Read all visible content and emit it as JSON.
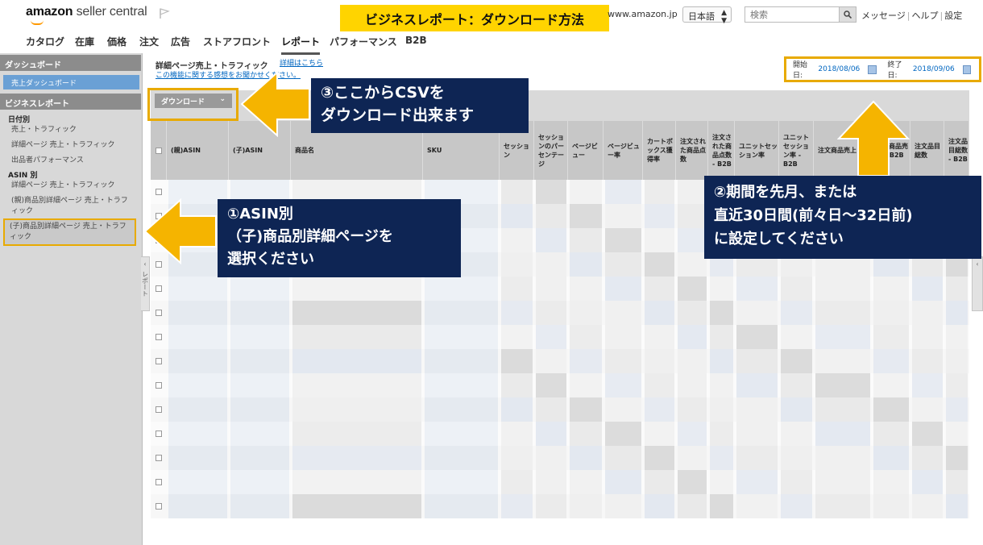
{
  "header": {
    "logo_main": "amazon",
    "logo_sub": "seller central",
    "banner": "ビジネスレポート：ダウンロード方法",
    "domain": "www.amazon.jp",
    "language": "日本語",
    "search_placeholder": "検索",
    "links": [
      "メッセージ",
      "ヘルプ",
      "設定"
    ]
  },
  "nav": {
    "items": [
      "カタログ",
      "在庫",
      "価格",
      "注文",
      "広告",
      "ストアフロント",
      "レポート",
      "パフォーマンス",
      "B2B"
    ],
    "active": "レポート"
  },
  "sidebar": {
    "dashboard_head": "ダッシュボード",
    "dashboard_item": "売上ダッシュボード",
    "report_head": "ビジネスレポート",
    "by_date_label": "日付別",
    "by_date_items": [
      "売上・トラフィック",
      "詳細ページ 売上・トラフィック",
      "出品者パフォーマンス"
    ],
    "by_asin_label": "ASIN 別",
    "by_asin_items": [
      "詳細ページ 売上・トラフィック",
      "(親)商品別詳細ページ 売上・トラフィック",
      "(子)商品別詳細ページ 売上・トラフィック"
    ],
    "toggle_label": "レポート"
  },
  "main": {
    "title": "詳細ページ売上・トラフィック",
    "detail_link": "詳細はこちら",
    "feedback_link": "この機能に関する感想をお聞かせください。",
    "start_label": "開始日:",
    "start_value": "2018/08/06",
    "end_label": "終了日:",
    "end_value": "2018/09/06",
    "download_label": "ダウンロード"
  },
  "table": {
    "columns": [
      "(親)ASIN",
      "(子)ASIN",
      "商品名",
      "SKU",
      "セッション",
      "セッションのパーセンテージ",
      "ページビュー",
      "ページビュー率",
      "カートボックス獲得率",
      "注文された商品点数",
      "注文された商品点数 - B2B",
      "ユニットセッション率",
      "ユニットセッション率 - B2B",
      "注文商品売上",
      "注文商品売上 - B2B",
      "注文品目総数",
      "注文品目総数 - B2B"
    ],
    "row_count": 14
  },
  "callouts": {
    "one": [
      "①ASIN別",
      "（子)商品別詳細ページを",
      "選択ください"
    ],
    "two": [
      "②期間を先月、または",
      "直近30日間(前々日～32日前)",
      "に設定してください"
    ],
    "three": [
      "③ここからCSVを",
      "ダウンロード出来ます"
    ]
  },
  "colors": {
    "banner": "#ffd400",
    "highlight": "#e8aa00",
    "callout_bg": "#0e2554",
    "link": "#0066c0"
  }
}
